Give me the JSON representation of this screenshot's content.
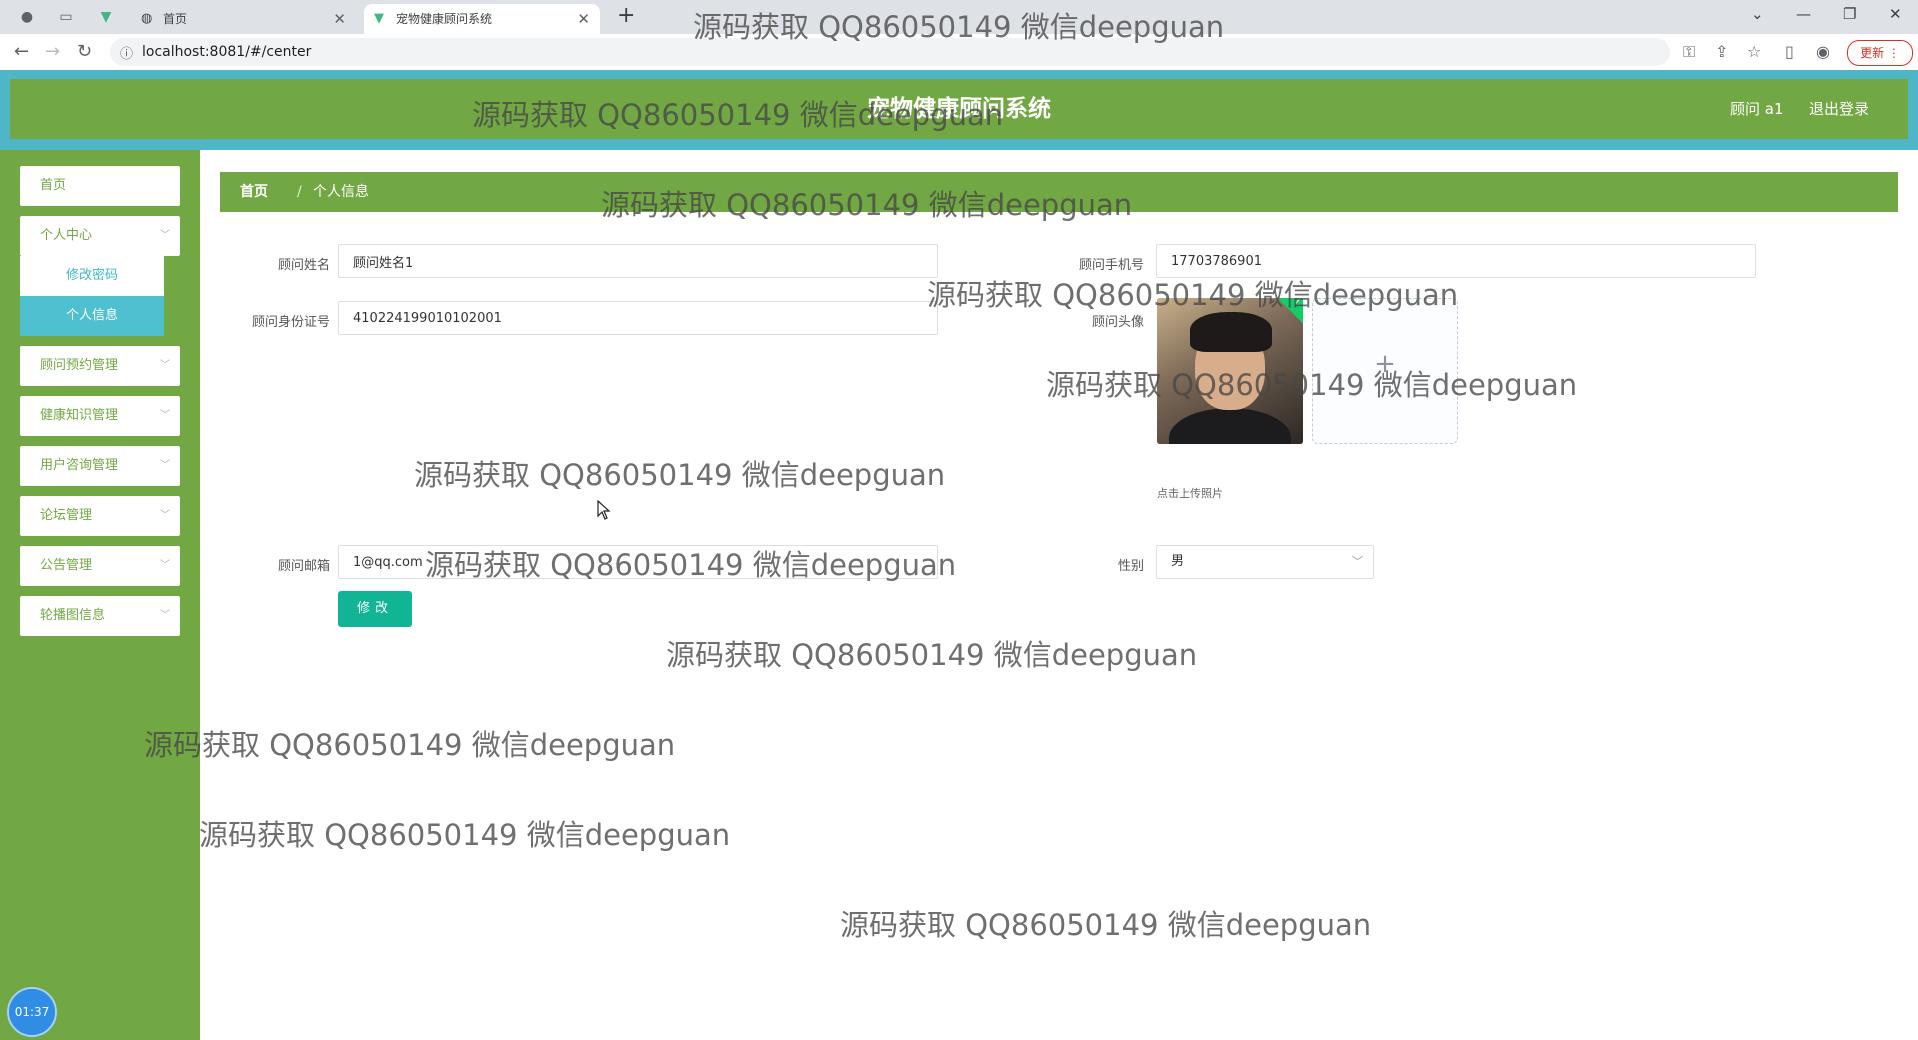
{
  "browser": {
    "tabs": [
      {
        "title": "首页",
        "active": false
      },
      {
        "title": "宠物健康顾问系统",
        "active": true
      }
    ],
    "url": "localhost:8081/#/center",
    "update_label": "更新",
    "icons": {
      "back": "back-arrow-icon",
      "forward": "forward-arrow-icon",
      "reload": "reload-icon",
      "info": "info-icon"
    }
  },
  "header": {
    "title": "宠物健康顾问系统",
    "user": "顾问 a1",
    "logout": "退出登录"
  },
  "sidebar": {
    "items": [
      {
        "label": "首页",
        "expandable": false
      },
      {
        "label": "个人中心",
        "expandable": true
      },
      {
        "label": "顾问预约管理",
        "expandable": true
      },
      {
        "label": "健康知识管理",
        "expandable": true
      },
      {
        "label": "用户咨询管理",
        "expandable": true
      },
      {
        "label": "论坛管理",
        "expandable": true
      },
      {
        "label": "公告管理",
        "expandable": true
      },
      {
        "label": "轮播图信息",
        "expandable": true
      }
    ],
    "submenu": [
      {
        "label": "修改密码",
        "active": false
      },
      {
        "label": "个人信息",
        "active": true
      }
    ],
    "timer": "01:37"
  },
  "breadcrumb": {
    "home": "首页",
    "separator": "/",
    "current": "个人信息"
  },
  "form": {
    "name": {
      "label": "顾问姓名",
      "value": "顾问姓名1"
    },
    "phone": {
      "label": "顾问手机号",
      "value": "17703786901"
    },
    "idcard": {
      "label": "顾问身份证号",
      "value": "410224199010102001"
    },
    "avatar": {
      "label": "顾问头像",
      "tip": "点击上传照片",
      "upload_symbol": "+"
    },
    "email": {
      "label": "顾问邮箱",
      "value": "1@qq.com"
    },
    "gender": {
      "label": "性别",
      "value": "男"
    },
    "submit_label": "修改"
  },
  "watermark": "源码获取 QQ86050149 微信deepguan",
  "colors": {
    "header_border": "#4eb6c6",
    "primary_green": "#72a843",
    "teal_button": "#11b596",
    "submenu_active": "#4fc0cf"
  }
}
